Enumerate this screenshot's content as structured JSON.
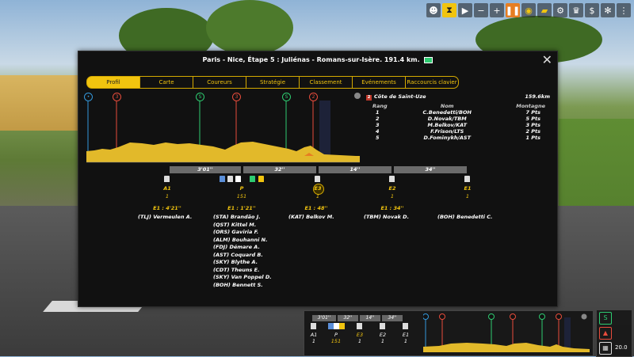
{
  "toolbar": {
    "icons": [
      "user-icon",
      "hourglass-icon",
      "play-icon",
      "minus-icon",
      "plus-icon",
      "pause-icon",
      "eye-icon",
      "jersey-icon",
      "bike-icon",
      "trophy-icon",
      "euro-icon",
      "settings-icon",
      "more-icon"
    ]
  },
  "panel": {
    "title": "Paris - Nice, Étape 5 : Juliénas - Romans-sur-Isère. 191.4 km.",
    "close_icon": "✕",
    "tabs": [
      "Profil",
      "Carte",
      "Coureurs",
      "Stratégie",
      "Classement",
      "Evénements",
      "Raccourcis clavier"
    ],
    "active_tab": "Profil"
  },
  "profile": {
    "markers": [
      {
        "type": "start",
        "label": ""
      },
      {
        "type": "climb",
        "label": "3"
      },
      {
        "type": "sprint",
        "label": "S"
      },
      {
        "type": "climb",
        "label": "3"
      },
      {
        "type": "sprint",
        "label": "S"
      },
      {
        "type": "climb",
        "label": "2"
      }
    ]
  },
  "climb": {
    "category": "2",
    "name": "Côte de Saint-Uze",
    "distance": "159.6km",
    "headers": [
      "Rang",
      "Nom",
      "Montagne"
    ],
    "rows": [
      [
        "1",
        "C.Benedetti/BOH",
        "7 Pts"
      ],
      [
        "2",
        "D.Novak/TBM",
        "5 Pts"
      ],
      [
        "3",
        "M.Belkov/KAT",
        "3 Pts"
      ],
      [
        "4",
        "F.Frison/LTS",
        "2 Pts"
      ],
      [
        "5",
        "D.Fominykh/AST",
        "1 Pts"
      ]
    ]
  },
  "gaps": {
    "g1": "3'01''",
    "g2": "32''",
    "g3": "14''",
    "g4": "34''"
  },
  "groups": [
    {
      "name": "A1",
      "count": "1",
      "gap": "E1 : 4'21''",
      "riders": [
        "(TLJ) Vermeulen A."
      ]
    },
    {
      "name": "P",
      "count": "151",
      "gap": "E1 : 1'21''",
      "riders": [
        "(STA) Brandão J.",
        "(QST) Kittel M.",
        "(ORS) Gaviria F.",
        "(ALM) Bouhanni N.",
        "(FDJ) Démare A.",
        "(AST) Coquard B.",
        "(SKY) Blythe A.",
        "(CDT) Theuns E.",
        "(SKY) Van Poppel D.",
        "(BOH) Bennett S."
      ]
    },
    {
      "name": "E3",
      "count": "1",
      "gap": "E1 : 48''",
      "riders": [
        "(KAT) Belkov M."
      ]
    },
    {
      "name": "E2",
      "count": "1",
      "gap": "E1 : 34''",
      "riders": [
        "(TBM) Novak D."
      ]
    },
    {
      "name": "E1",
      "count": "1",
      "gap": "",
      "riders": [
        "(BOH) Benedetti C."
      ]
    }
  ],
  "mini": {
    "gaps": [
      "3'01''",
      "32''",
      "14''",
      "34''"
    ],
    "labels": [
      {
        "name": "A1",
        "count": "1"
      },
      {
        "name": "P",
        "count": "151"
      },
      {
        "name": "E3",
        "count": "1"
      },
      {
        "name": "E2",
        "count": "1"
      },
      {
        "name": "E1",
        "count": "1"
      }
    ],
    "speed": "20.0"
  },
  "colors": {
    "accent": "#f1c40f",
    "panel_bg": "#111111",
    "sprint": "#2ecc71",
    "climb": "#e74c3c",
    "start": "#3498db"
  }
}
